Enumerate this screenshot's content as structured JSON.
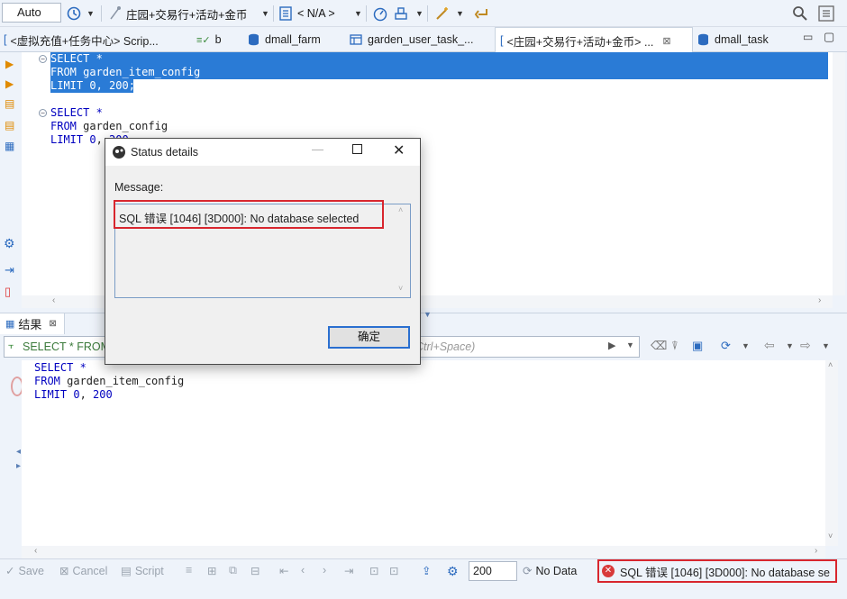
{
  "toolbar": {
    "transaction_mode": "Auto",
    "connection_name": "庄园+交易行+活动+金币",
    "schema_name": "< N/A >"
  },
  "editor_tabs": [
    {
      "label": "<虚拟充值+任务中心> Scrip...",
      "icon": "script-icon"
    },
    {
      "label": "b",
      "icon": "sql-console-icon"
    },
    {
      "label": "dmall_farm",
      "icon": "database-icon"
    },
    {
      "label": "garden_user_task_...",
      "icon": "table-icon"
    },
    {
      "label": "<庄园+交易行+活动+金币> ...",
      "icon": "script-icon",
      "active": true
    },
    {
      "label": "dmall_task",
      "icon": "database-icon"
    }
  ],
  "editor": {
    "block1": [
      "SELECT *",
      "FROM garden_item_config",
      "LIMIT 0, 200;"
    ],
    "block2": [
      "SELECT *",
      "FROM garden_config",
      "LIMIT 0, 200"
    ]
  },
  "results": {
    "tab_label": "结果",
    "filter_text": "SELECT * FROM",
    "filter_placeholder": "Ctrl+Space)",
    "query_lines": [
      "SELECT *",
      "FROM garden_item_config",
      "LIMIT 0, 200"
    ]
  },
  "bottom_bar": {
    "save": "Save",
    "cancel": "Cancel",
    "script": "Script",
    "fetch_size": "200",
    "no_data": "No Data",
    "error": "SQL 错误 [1046] [3D000]: No database se"
  },
  "dialog": {
    "title": "Status details",
    "message_label": "Message:",
    "message": "SQL 错误 [1046] [3D000]: No database selected",
    "ok_label": "确定"
  },
  "colors": {
    "selection": "#2a7bd6",
    "keyword": "#0000c0",
    "highlight_box": "#d8262e",
    "error_icon": "#d83a3a"
  }
}
